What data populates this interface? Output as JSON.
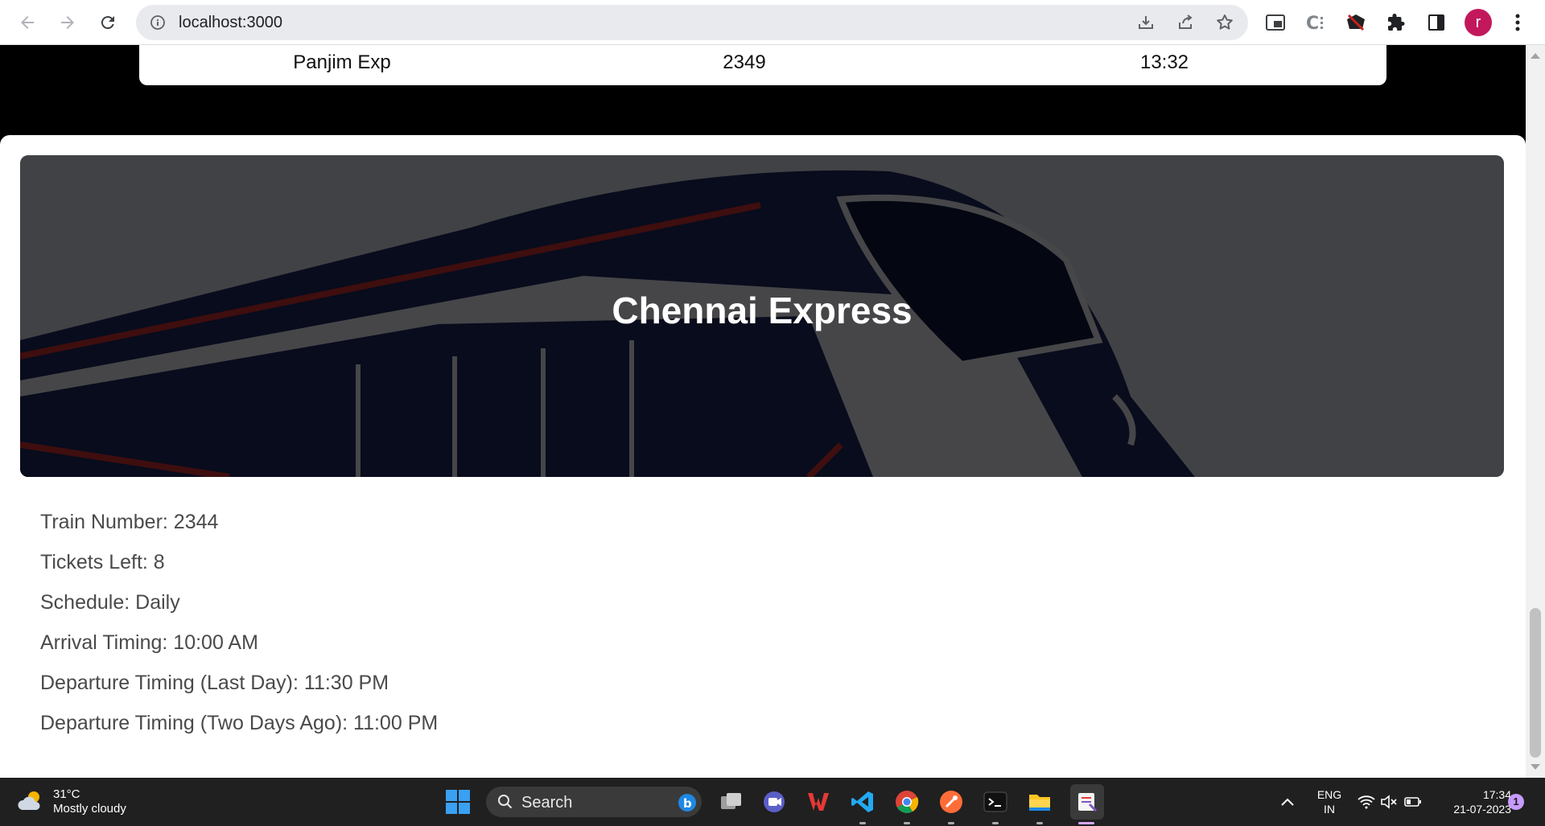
{
  "browser": {
    "url": "localhost:3000",
    "avatar_letter": "r",
    "avatar_color": "#c2185b"
  },
  "previous_train": {
    "name": "Panjim Exp",
    "number": "2349",
    "time": "13:32"
  },
  "train": {
    "title": "Chennai Express",
    "train_number": "Train Number: 2344",
    "tickets_left": "Tickets Left: 8",
    "schedule": "Schedule: Daily",
    "arrival": "Arrival Timing: 10:00 AM",
    "departure_last_day": "Departure Timing (Last Day): 11:30 PM",
    "departure_two_days_ago": "Departure Timing (Two Days Ago): 11:00 PM"
  },
  "taskbar": {
    "temperature": "31°C",
    "weather": "Mostly cloudy",
    "search_label": "Search",
    "lang": "ENG",
    "region": "IN",
    "time": "17:34",
    "date": "21-07-2023",
    "notification_count": "1"
  },
  "icons": [
    "back-icon",
    "forward-icon",
    "reload-icon",
    "info-icon",
    "install-icon",
    "share-icon",
    "star-icon",
    "pip-icon",
    "extension-c-icon",
    "extension-game-icon",
    "puzzle-icon",
    "sidepanel-icon",
    "menu-dots-icon",
    "windows-start-icon",
    "search-icon",
    "bing-icon",
    "task-view-icon",
    "chat-icon",
    "office-icon",
    "vscode-icon",
    "chrome-icon",
    "postman-icon",
    "terminal-icon",
    "file-explorer-icon",
    "snipping-tool-icon",
    "chevron-up-icon",
    "wifi-icon",
    "speaker-muted-icon",
    "battery-icon"
  ]
}
